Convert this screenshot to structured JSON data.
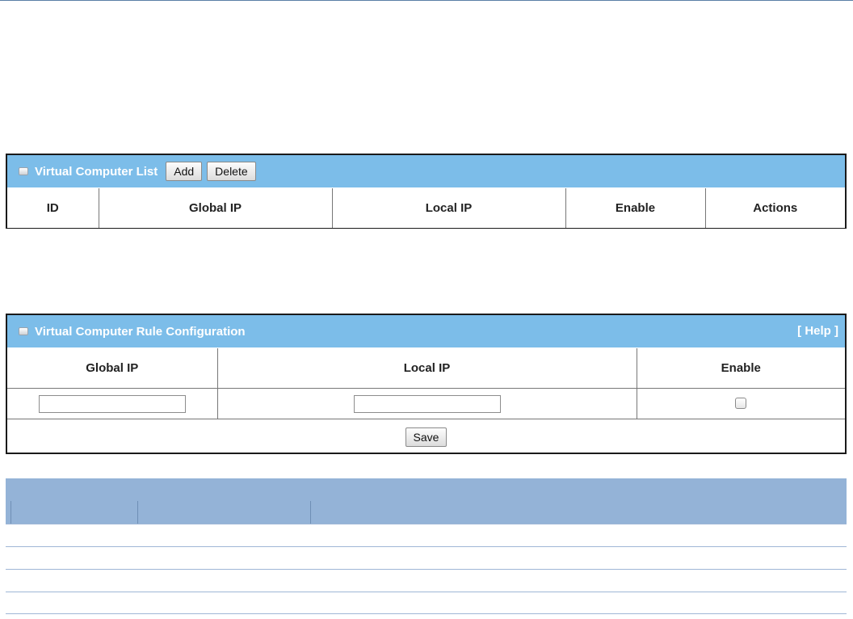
{
  "list_panel": {
    "title": "Virtual Computer List",
    "add_label": "Add",
    "delete_label": "Delete",
    "columns": [
      "ID",
      "Global IP",
      "Local IP",
      "Enable",
      "Actions"
    ]
  },
  "rule_panel": {
    "title": "Virtual Computer Rule Configuration",
    "help_label": "[ Help ]",
    "columns": [
      "Global IP",
      "Local IP",
      "Enable"
    ],
    "global_ip_value": "",
    "local_ip_value": "",
    "enable_checked": false,
    "save_label": "Save"
  },
  "colors": {
    "panel_header": "#7cbde9",
    "panel_border": "#1a1a1a",
    "bottom_table_header": "#94b3d7"
  }
}
